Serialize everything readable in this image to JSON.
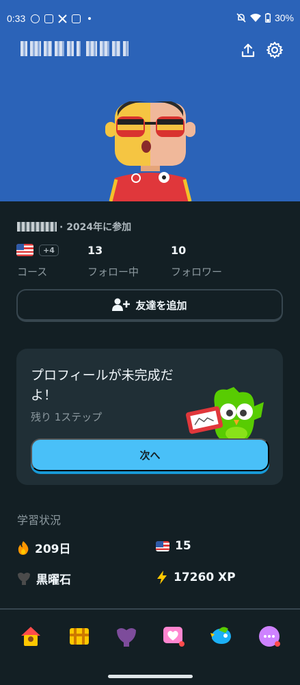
{
  "status_bar": {
    "time": "0:33",
    "battery": "30%",
    "left_icons": [
      "line-icon",
      "instagram-icon",
      "x-icon",
      "instagram-icon",
      "dot-icon"
    ],
    "right_icons": [
      "mute-icon",
      "wifi-icon",
      "battery-icon"
    ]
  },
  "header": {
    "background_color": "#2b63b8",
    "share_icon": "share-icon",
    "settings_icon": "gear-icon"
  },
  "profile": {
    "joined_text": "· 2024年に参加",
    "extra_courses_badge": "+4",
    "stats": [
      {
        "value": "",
        "label": "コース"
      },
      {
        "value": "13",
        "label": "フォロー中"
      },
      {
        "value": "10",
        "label": "フォロワー"
      }
    ],
    "add_friend_label": "友達を追加"
  },
  "profile_card": {
    "title": "プロフィールが未完成だよ！",
    "subtitle": "残り 1ステップ",
    "button_label": "次へ",
    "button_color": "#49c0f8"
  },
  "progress": {
    "section_title": "学習状況",
    "streak": "209日",
    "language_count": "15",
    "league": "黒曜石",
    "xp": "17260 XP"
  },
  "tabs": [
    {
      "name": "home",
      "icon": "home-icon"
    },
    {
      "name": "quests",
      "icon": "treasure-chest-icon"
    },
    {
      "name": "leagues",
      "icon": "league-shield-icon"
    },
    {
      "name": "hearts",
      "icon": "heart-icon"
    },
    {
      "name": "practice",
      "icon": "bird-icon"
    },
    {
      "name": "more",
      "icon": "more-icon"
    }
  ]
}
